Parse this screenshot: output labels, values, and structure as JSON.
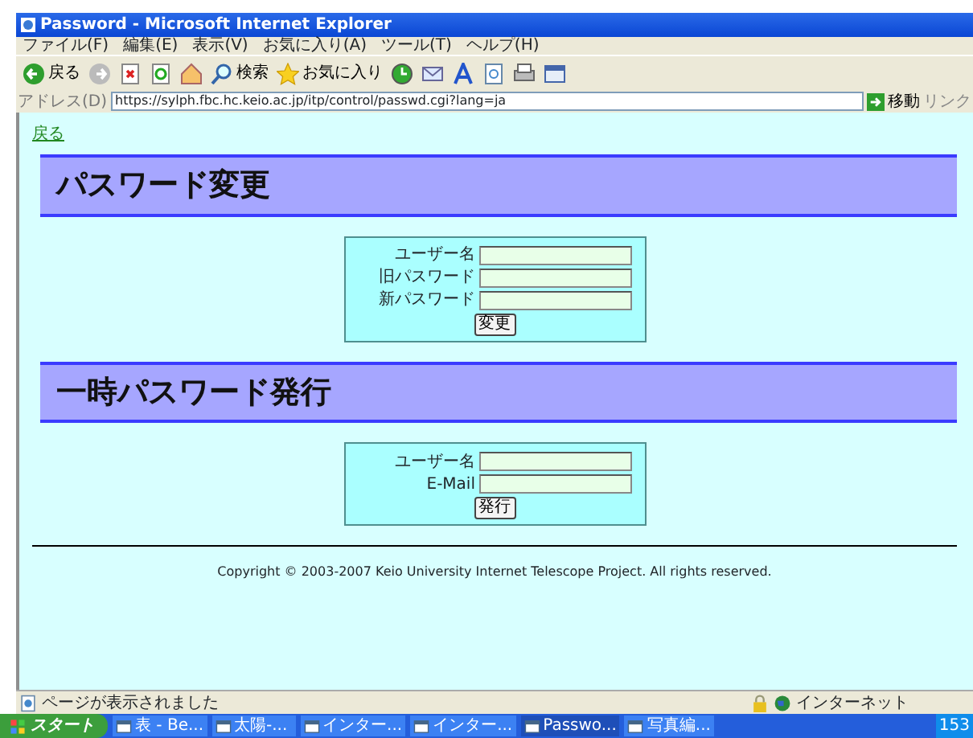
{
  "window": {
    "title": "Password - Microsoft Internet Explorer"
  },
  "menu": [
    "ファイル(F)",
    "編集(E)",
    "表示(V)",
    "お気に入り(A)",
    "ツール(T)",
    "ヘルプ(H)"
  ],
  "toolbar": [
    {
      "kind": "back",
      "label": "戻る"
    },
    {
      "kind": "forward"
    },
    {
      "kind": "stop"
    },
    {
      "kind": "refresh"
    },
    {
      "kind": "home"
    },
    {
      "kind": "search",
      "label": "検索"
    },
    {
      "kind": "favorites",
      "label": "お気に入り"
    },
    {
      "kind": "history"
    },
    {
      "kind": "mail"
    },
    {
      "kind": "font"
    },
    {
      "kind": "page"
    },
    {
      "kind": "print"
    },
    {
      "kind": "edit"
    }
  ],
  "address": {
    "label": "アドレス(D)",
    "url": "https://sylph.fbc.hc.keio.ac.jp/itp/control/passwd.cgi?lang=ja",
    "go": "移動",
    "links": "リンク"
  },
  "page": {
    "back_link": "戻る",
    "sections": [
      {
        "heading": "パスワード変更",
        "fields": [
          {
            "label": "ユーザー名"
          },
          {
            "label": "旧パスワード"
          },
          {
            "label": "新パスワード"
          }
        ],
        "button": "変更"
      },
      {
        "heading": "一時パスワード発行",
        "fields": [
          {
            "label": "ユーザー名"
          },
          {
            "label": "E-Mail"
          }
        ],
        "button": "発行"
      }
    ],
    "copyright": "Copyright © 2003-2007 Keio University Internet Telescope Project. All rights reserved."
  },
  "status": {
    "text": "ページが表示されました",
    "zone": "インターネット"
  },
  "taskbar": {
    "start": "スタート",
    "tasks": [
      {
        "label": "表 - Be...",
        "selected": false
      },
      {
        "label": "太陽-...",
        "selected": false
      },
      {
        "label": "インター...",
        "selected": false
      },
      {
        "label": "インター...",
        "selected": false
      },
      {
        "label": "Passwo...",
        "selected": true
      },
      {
        "label": "写真編...",
        "selected": false
      }
    ],
    "clock": "153"
  }
}
